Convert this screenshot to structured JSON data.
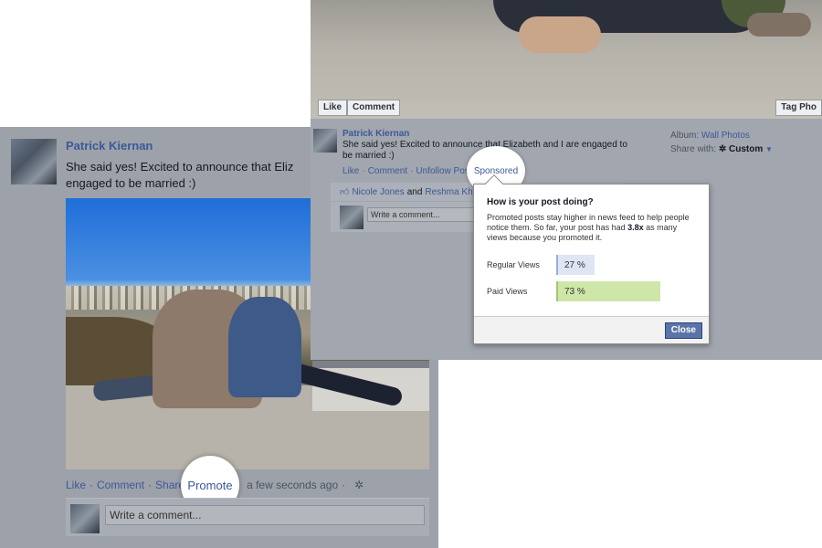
{
  "left_post": {
    "author": "Patrick Kiernan",
    "text": "She said yes! Excited to announce that Eliz engaged to be married :)",
    "actions": {
      "like": "Like",
      "comment": "Comment",
      "share": "Share",
      "promote": "Promote",
      "time": "a few seconds ago",
      "sep": "·"
    },
    "comment_placeholder": "Write a comment..."
  },
  "right_post": {
    "photo_buttons": {
      "like": "Like",
      "comment": "Comment",
      "tag_photo": "Tag Pho"
    },
    "author": "Patrick Kiernan",
    "text": "She said yes! Excited to announce that Elizabeth and I are engaged to be married :)",
    "album_label": "Album:",
    "album_value": "Wall Photos",
    "share_with_label": "Share with:",
    "share_with_value": "Custom",
    "actions": {
      "like": "Like",
      "comment": "Comment",
      "unfollow": "Unfollow Post",
      "sponsored": "Sponsored",
      "sep": "·"
    },
    "likes": {
      "name1": "Nicole Jones",
      "and": "and",
      "name2": "Reshma Khil"
    },
    "comment_placeholder": "Write a comment..."
  },
  "popover": {
    "title": "How is your post doing?",
    "desc_before": "Promoted posts stay higher in news feed to help people notice them. So far, your post has had",
    "desc_multiplier": "3.8x",
    "desc_after": "as many views because you promoted it.",
    "stats": [
      {
        "label": "Regular Views",
        "value": "27",
        "unit": "%",
        "percent": 27
      },
      {
        "label": "Paid Views",
        "value": "73",
        "unit": "%",
        "percent": 73
      }
    ],
    "close_label": "Close"
  },
  "colors": {
    "link": "#3b5998",
    "regular_bar": "#dfe5f2",
    "paid_bar": "#cfe6a9",
    "close_button": "#5b74a8"
  }
}
